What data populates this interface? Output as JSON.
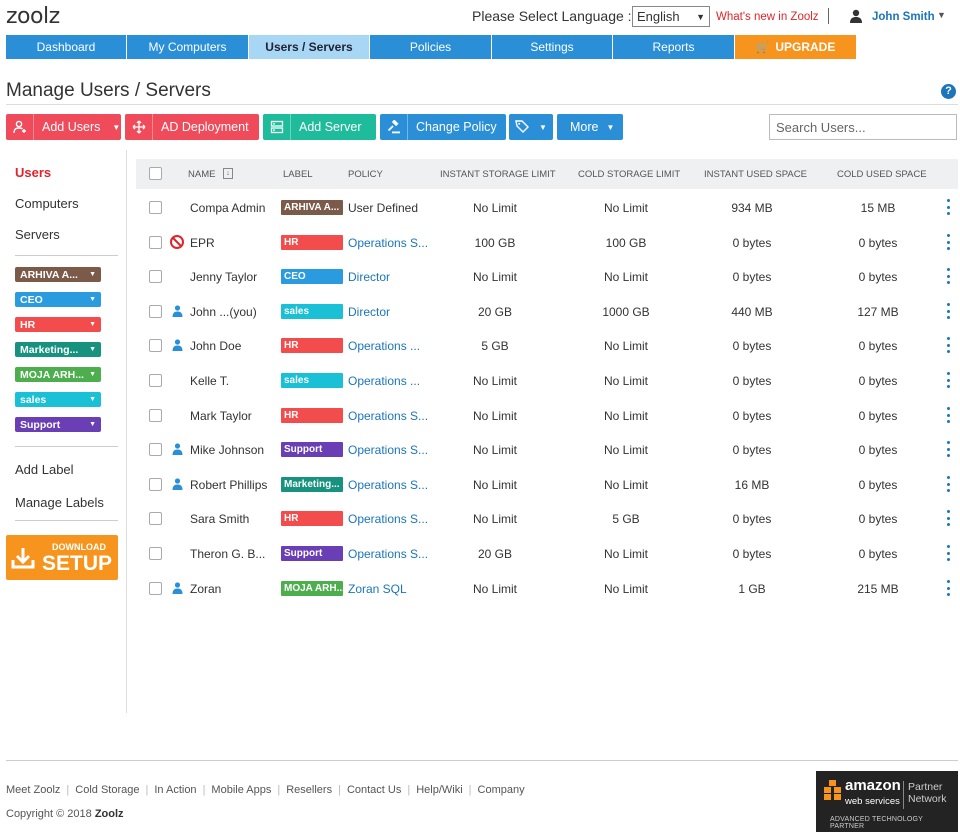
{
  "header": {
    "logo": "zoolz",
    "language_prompt": "Please Select Language :",
    "language_value": "English",
    "whats_new": "What's new in Zoolz",
    "user_name": "John Smith"
  },
  "nav": [
    {
      "label": "Dashboard",
      "active": false
    },
    {
      "label": "My Computers",
      "active": false
    },
    {
      "label": "Users / Servers",
      "active": true
    },
    {
      "label": "Policies",
      "active": false
    },
    {
      "label": "Settings",
      "active": false
    },
    {
      "label": "Reports",
      "active": false
    },
    {
      "label": "UPGRADE",
      "active": false
    }
  ],
  "page_title": "Manage Users / Servers",
  "help_glyph": "?",
  "toolbar": {
    "add_users": "Add Users",
    "ad_deployment": "AD Deployment",
    "add_server": "Add Server",
    "change_policy": "Change Policy",
    "more": "More",
    "search_placeholder": "Search Users..."
  },
  "sidebar": {
    "links": [
      "Users",
      "Computers",
      "Servers"
    ],
    "labels": [
      {
        "name": "ARHIVA A...",
        "color": "#7b5a4a"
      },
      {
        "name": "CEO",
        "color": "#2b9be0"
      },
      {
        "name": "HR",
        "color": "#f24c4c"
      },
      {
        "name": "Marketing...",
        "color": "#17927f"
      },
      {
        "name": "MOJA ARH...",
        "color": "#4cae4c"
      },
      {
        "name": "sales",
        "color": "#19c0d6"
      },
      {
        "name": "Support",
        "color": "#6a3fb5"
      }
    ],
    "add_label": "Add Label",
    "manage_labels": "Manage Labels",
    "download_top": "DOWNLOAD",
    "download_big": "SETUP"
  },
  "table": {
    "headers": [
      "NAME",
      "LABEL",
      "POLICY",
      "INSTANT STORAGE LIMIT",
      "COLD STORAGE LIMIT",
      "INSTANT USED SPACE",
      "COLD USED SPACE"
    ],
    "rows": [
      {
        "name": "Compa Admin",
        "icon": "none",
        "label": "ARHIVA A...",
        "label_color": "#7b5a4a",
        "policy": "User Defined",
        "policy_link": false,
        "instant_limit": "No Limit",
        "cold_limit": "No Limit",
        "instant_used": "934 MB",
        "cold_used": "15 MB"
      },
      {
        "name": "EPR",
        "icon": "ban",
        "label": "HR",
        "label_color": "#f24c4c",
        "policy": "Operations S...",
        "policy_link": true,
        "instant_limit": "100 GB",
        "cold_limit": "100 GB",
        "instant_used": "0 bytes",
        "cold_used": "0 bytes"
      },
      {
        "name": "Jenny Taylor",
        "icon": "none",
        "label": "CEO",
        "label_color": "#2b9be0",
        "policy": "Director",
        "policy_link": true,
        "instant_limit": "No Limit",
        "cold_limit": "No Limit",
        "instant_used": "0 bytes",
        "cold_used": "0 bytes"
      },
      {
        "name": "John ...(you)",
        "icon": "person",
        "label": "sales",
        "label_color": "#19c0d6",
        "policy": "Director",
        "policy_link": true,
        "instant_limit": "20 GB",
        "cold_limit": "1000 GB",
        "instant_used": "440 MB",
        "cold_used": "127 MB"
      },
      {
        "name": "John Doe",
        "icon": "person",
        "label": "HR",
        "label_color": "#f24c4c",
        "policy": "Operations ...",
        "policy_link": true,
        "instant_limit": "5 GB",
        "cold_limit": "No Limit",
        "instant_used": "0 bytes",
        "cold_used": "0 bytes"
      },
      {
        "name": "Kelle T.",
        "icon": "none",
        "label": "sales",
        "label_color": "#19c0d6",
        "policy": "Operations ...",
        "policy_link": true,
        "instant_limit": "No Limit",
        "cold_limit": "No Limit",
        "instant_used": "0 bytes",
        "cold_used": "0 bytes"
      },
      {
        "name": "Mark Taylor",
        "icon": "none",
        "label": "HR",
        "label_color": "#f24c4c",
        "policy": "Operations S...",
        "policy_link": true,
        "instant_limit": "No Limit",
        "cold_limit": "No Limit",
        "instant_used": "0 bytes",
        "cold_used": "0 bytes"
      },
      {
        "name": "Mike Johnson",
        "icon": "person",
        "label": "Support",
        "label_color": "#6a3fb5",
        "policy": "Operations S...",
        "policy_link": true,
        "instant_limit": "No Limit",
        "cold_limit": "No Limit",
        "instant_used": "0 bytes",
        "cold_used": "0 bytes"
      },
      {
        "name": "Robert Phillips",
        "icon": "person",
        "label": "Marketing...",
        "label_color": "#17927f",
        "policy": "Operations S...",
        "policy_link": true,
        "instant_limit": "No Limit",
        "cold_limit": "No Limit",
        "instant_used": "16 MB",
        "cold_used": "0 bytes"
      },
      {
        "name": "Sara Smith",
        "icon": "none",
        "label": "HR",
        "label_color": "#f24c4c",
        "policy": "Operations S...",
        "policy_link": true,
        "instant_limit": "No Limit",
        "cold_limit": "5 GB",
        "instant_used": "0 bytes",
        "cold_used": "0 bytes"
      },
      {
        "name": "Theron G. B...",
        "icon": "none",
        "label": "Support",
        "label_color": "#6a3fb5",
        "policy": "Operations S...",
        "policy_link": true,
        "instant_limit": "20 GB",
        "cold_limit": "No Limit",
        "instant_used": "0 bytes",
        "cold_used": "0 bytes"
      },
      {
        "name": "Zoran",
        "icon": "person",
        "label": "MOJA ARH...",
        "label_color": "#4cae4c",
        "policy": "Zoran SQL",
        "policy_link": true,
        "instant_limit": "No Limit",
        "cold_limit": "No Limit",
        "instant_used": "1 GB",
        "cold_used": "215 MB"
      }
    ]
  },
  "footer": {
    "links": [
      "Meet Zoolz",
      "Cold Storage",
      "In Action",
      "Mobile Apps",
      "Resellers",
      "Contact Us",
      "Help/Wiki",
      "Company"
    ],
    "copyright_prefix": "Copyright © 2018",
    "copyright_brand": "Zoolz",
    "aws_amazon": "amazon",
    "aws_webservices": "web services",
    "aws_partner": "Partner",
    "aws_network": "Network",
    "aws_tag": "ADVANCED TECHNOLOGY PARTNER"
  },
  "colors": {
    "nav_blue": "#2b8fd8",
    "nav_active": "#a8d7f6",
    "upgrade": "#f7941d",
    "red_button": "#ef4b5a",
    "teal_button": "#1fbc9c",
    "link_blue": "#1b75bb",
    "alert_red": "#e0242a"
  }
}
